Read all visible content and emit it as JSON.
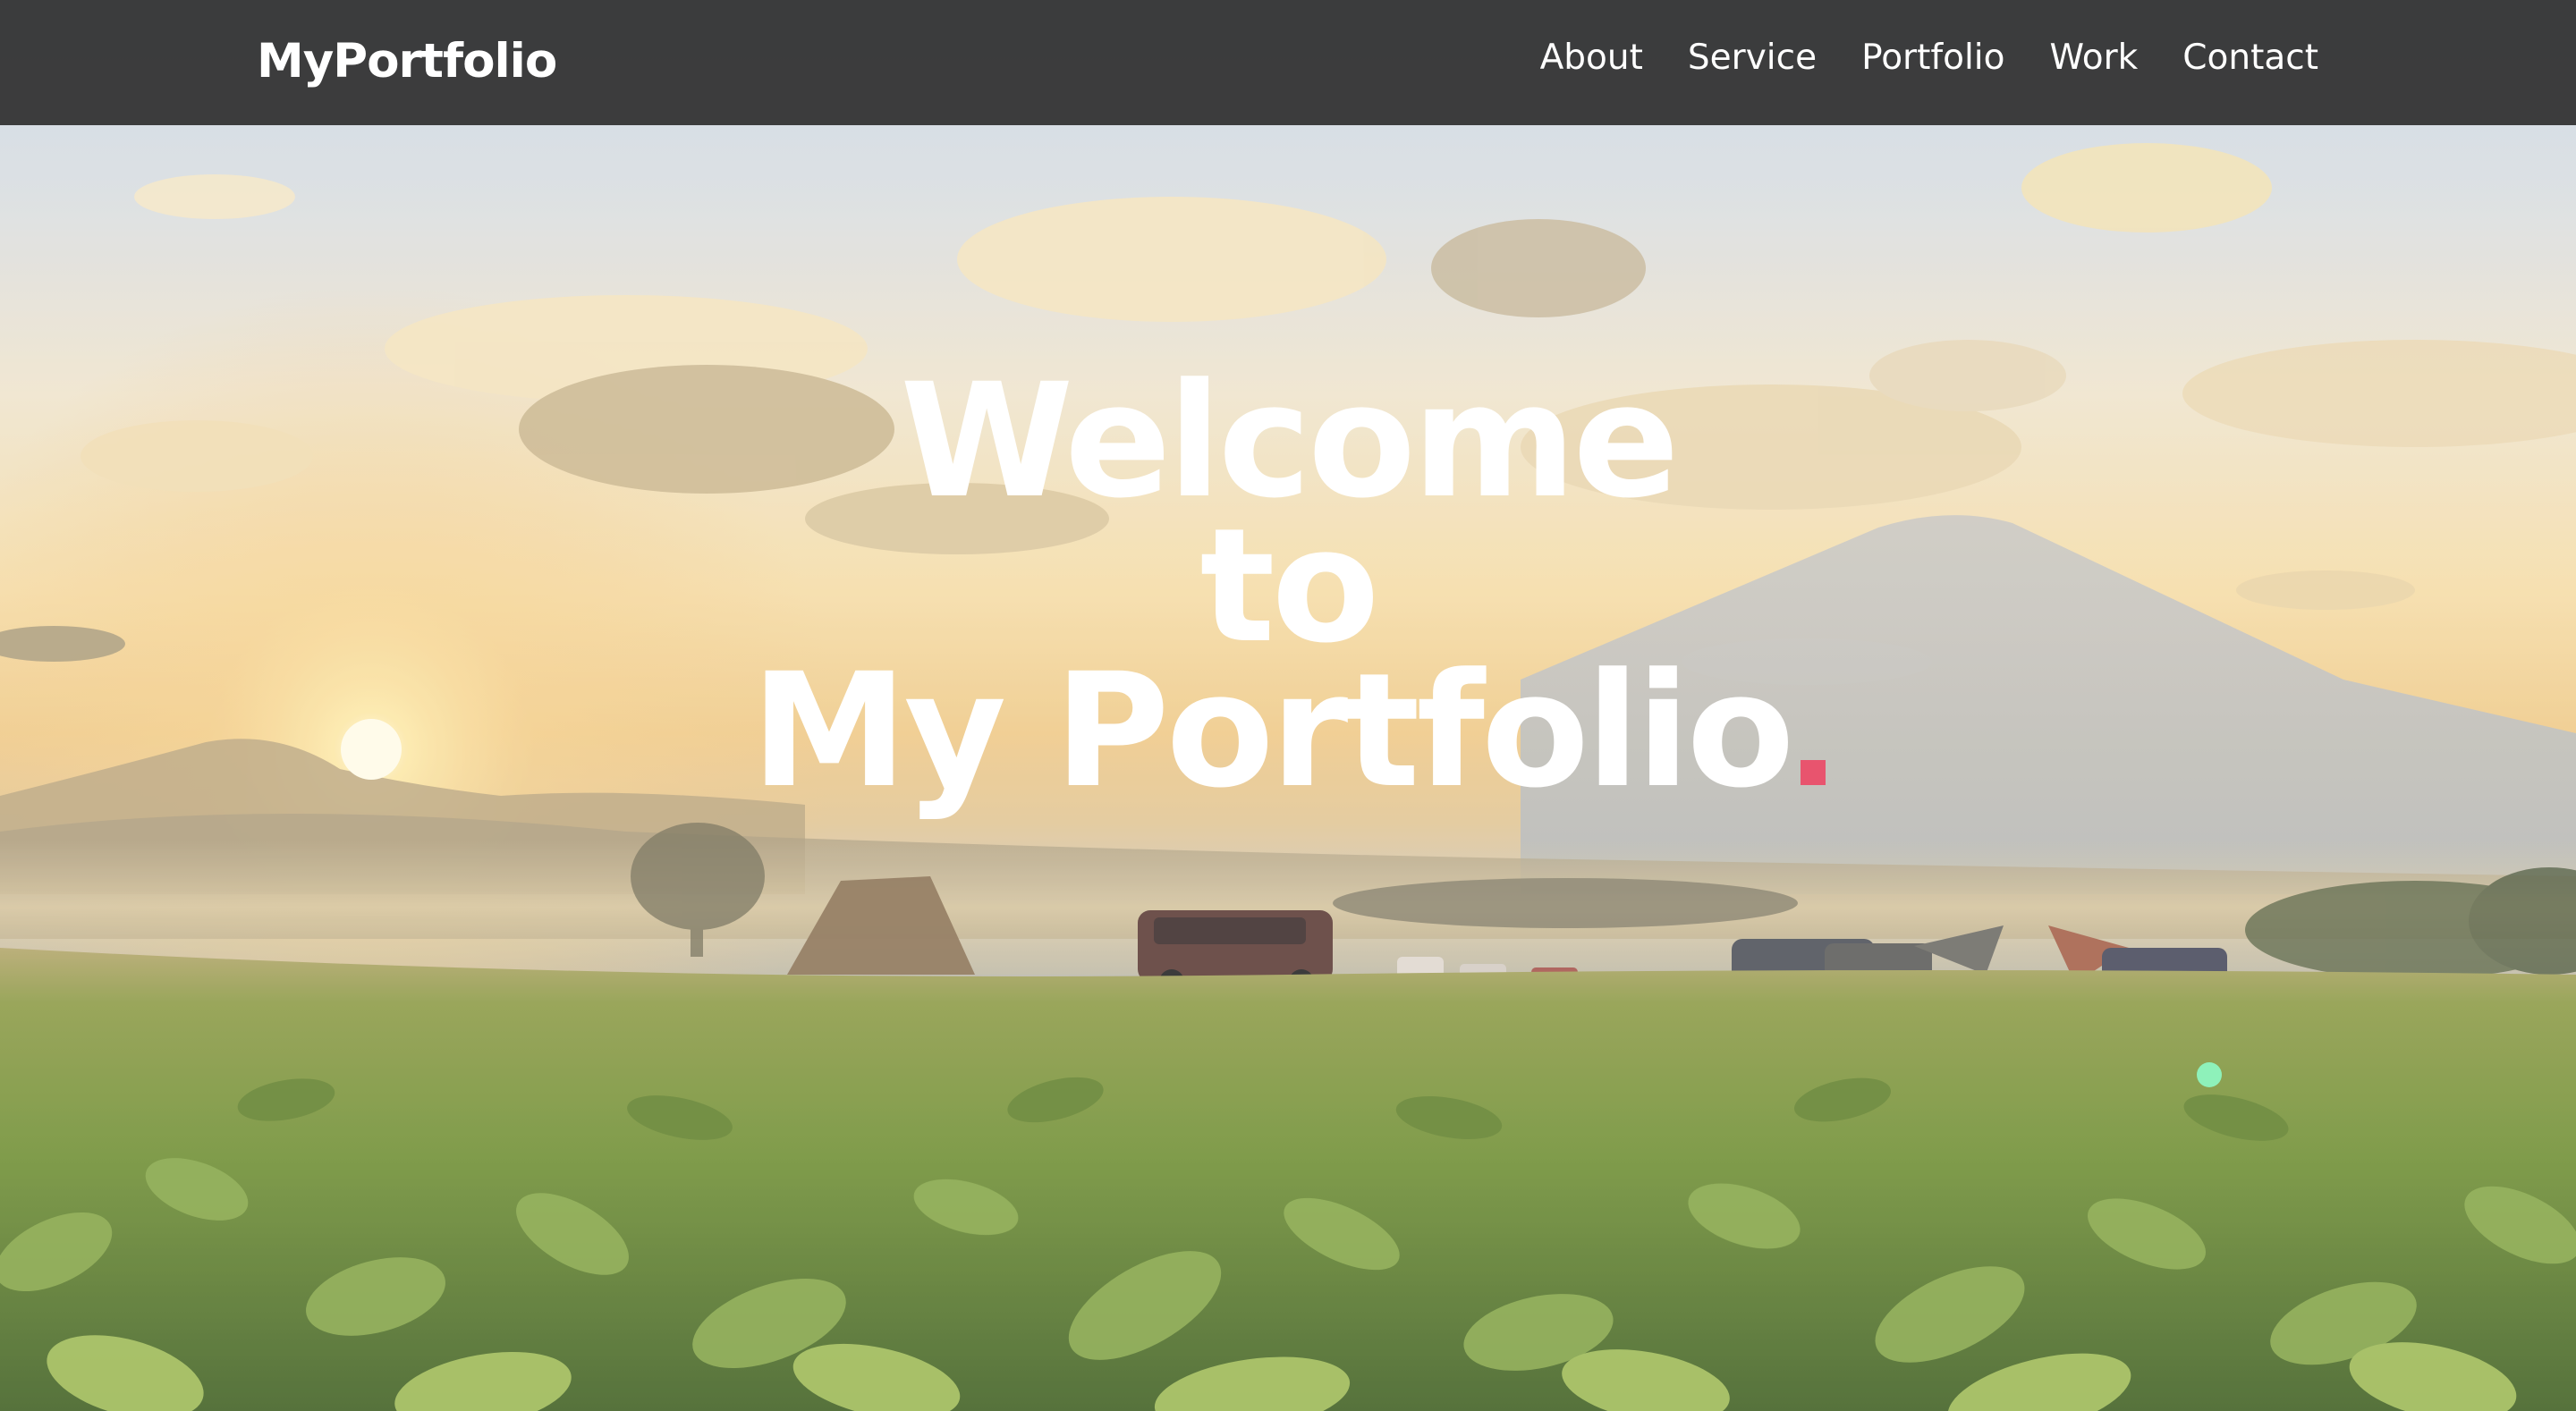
{
  "brand": {
    "logo_text": "MyPortfolio"
  },
  "nav": {
    "items": [
      {
        "label": "About"
      },
      {
        "label": "Service"
      },
      {
        "label": "Portfolio"
      },
      {
        "label": "Work"
      },
      {
        "label": "Contact"
      }
    ]
  },
  "hero": {
    "line1": "Welcome",
    "line2": "to",
    "line3": "My Portfolio",
    "accent_color": "#e8546e"
  },
  "colors": {
    "navbar_bg": "#333333",
    "text": "#ffffff"
  }
}
